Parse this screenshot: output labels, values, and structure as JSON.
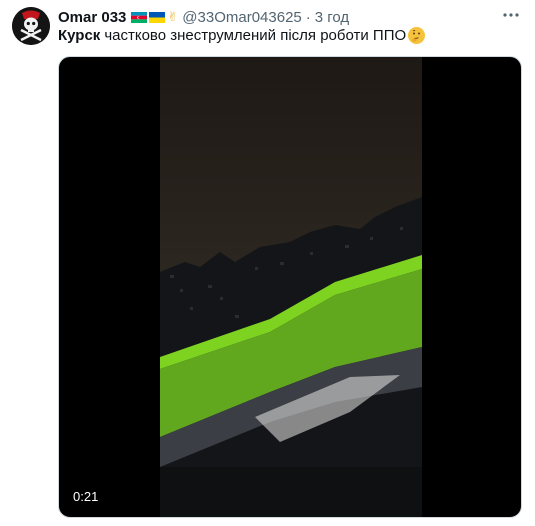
{
  "author": {
    "display_name": "Omar 033",
    "handle": "@33Omar043625",
    "separator": "·",
    "time": "3 год"
  },
  "header_icons": [
    "azerbaijan-flag-icon",
    "ukraine-flag-icon",
    "victory-hand-icon"
  ],
  "tweet": {
    "bold_word": "Курск",
    "body": "частково знеструмлений після роботи ППО",
    "emoji": "thinking-face-icon"
  },
  "video": {
    "duration": "0:21"
  },
  "colors": {
    "accent_green": "#7ed321",
    "text_primary": "#0f1419",
    "text_secondary": "#536471"
  }
}
